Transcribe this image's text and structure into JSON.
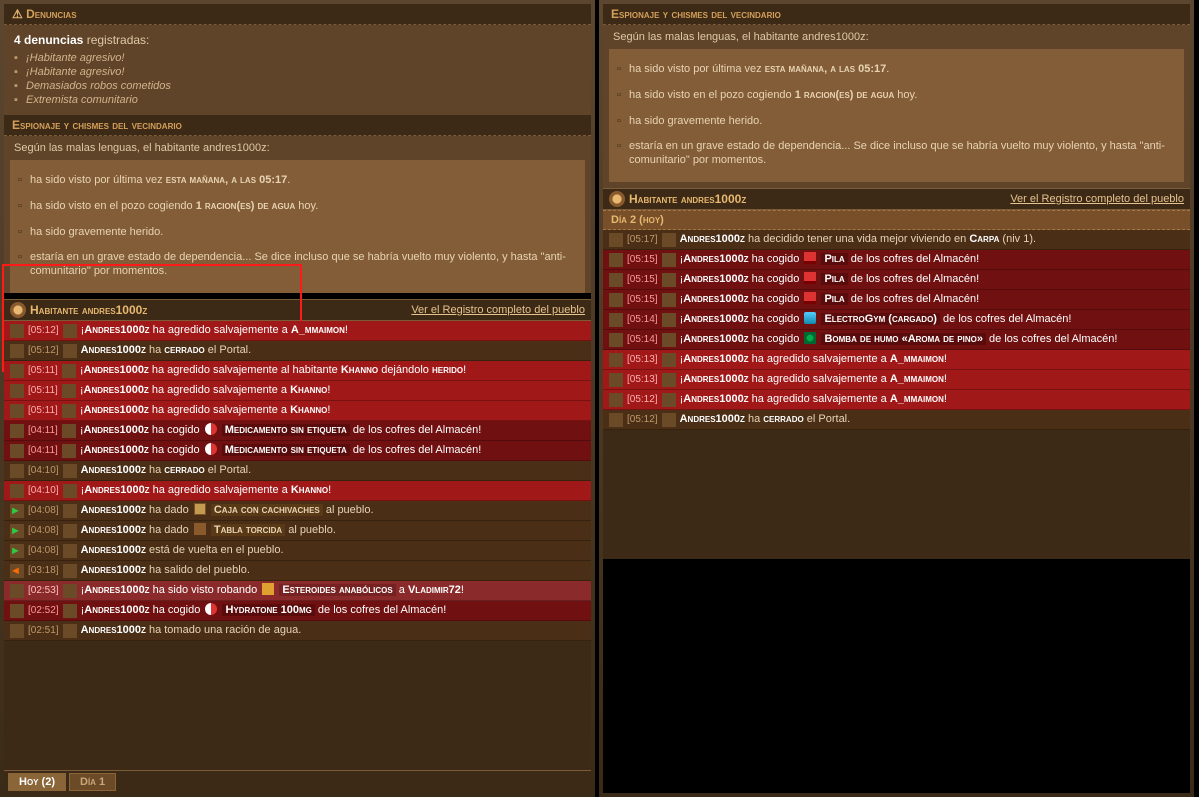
{
  "left": {
    "complaints": {
      "title": "Denuncias",
      "count_text_strong": "4 denuncias",
      "count_text_rest": " registradas:",
      "items": [
        "¡Habitante agresivo!",
        "¡Habitante agresivo!",
        "Demasiados robos cometidos",
        "Extremista comunitario"
      ]
    },
    "gossip": {
      "title": "Espionaje y chismes del vecindario",
      "intro": "Según las malas lenguas, el habitante andres1000z:",
      "lines": [
        {
          "html": "ha sido visto por última vez <strong class='sc'>esta mañana, a las 05:17</strong>."
        },
        {
          "html": "ha sido visto en el pozo cogiendo <strong class='sc'>1 racion(es) de agua</strong> hoy."
        },
        {
          "html": "ha sido gravemente herido."
        },
        {
          "html": "estaría en un grave estado de dependencia... Se dice incluso que se habría vuelto muy violento, y hasta \"anti-comunitario\" por momentos."
        }
      ]
    },
    "header": {
      "label": "Habitante andres1000z",
      "link": "Ver el Registro completo del pueblo"
    },
    "tabs": [
      {
        "label": "Hoy (2)",
        "active": true
      },
      {
        "label": "Día 1",
        "active": false
      }
    ],
    "log": [
      {
        "sev": "hi",
        "time": "[05:12]",
        "html": "¡<span class='nm'>Andres1000z</span> ha agredido salvajemente a <span class='nm'>A_mmaimon</span>!"
      },
      {
        "sev": "low",
        "time": "[05:12]",
        "html": "<span class='nm'>Andres1000z</span> ha <span class='nm'>cerrado</span> el Portal."
      },
      {
        "sev": "hi",
        "time": "[05:11]",
        "html": "¡<span class='nm'>Andres1000z</span> ha agredido salvajemente al habitante <span class='nm'>Khanno</span> dejándolo <span class='nm'>herido</span>!"
      },
      {
        "sev": "hi",
        "time": "[05:11]",
        "html": "¡<span class='nm'>Andres1000z</span> ha agredido salvajemente a <span class='nm'>Khanno</span>!"
      },
      {
        "sev": "hi",
        "time": "[05:11]",
        "html": "¡<span class='nm'>Andres1000z</span> ha agredido salvajemente a <span class='nm'>Khanno</span>!"
      },
      {
        "sev": "med",
        "time": "[04:11]",
        "html": "¡<span class='nm'>Andres1000z</span> ha cogido <span class='iicon pill'></span> <span class='itm'>Medicamento sin etiqueta</span> de los cofres del Almacén!"
      },
      {
        "sev": "med",
        "time": "[04:11]",
        "html": "¡<span class='nm'>Andres1000z</span> ha cogido <span class='iicon pill'></span> <span class='itm'>Medicamento sin etiqueta</span> de los cofres del Almacén!"
      },
      {
        "sev": "low",
        "time": "[04:10]",
        "html": "<span class='nm'>Andres1000z</span> ha <span class='nm'>cerrado</span> el Portal."
      },
      {
        "sev": "hi",
        "time": "[04:10]",
        "html": "¡<span class='nm'>Andres1000z</span> ha agredido salvajemente a <span class='nm'>Khanno</span>!"
      },
      {
        "sev": "low",
        "time": "[04:08]",
        "arrow": "in",
        "html": "<span class='nm'>Andres1000z</span> ha dado <span class='iicon box'></span> <span class='itm' style='background:#5a3a16;'>Caja con cachivaches</span> al pueblo."
      },
      {
        "sev": "low",
        "time": "[04:08]",
        "arrow": "in",
        "html": "<span class='nm'>Andres1000z</span> ha dado <span class='iicon wood'></span> <span class='itm' style='background:#5a3a16;'>Tabla torcida</span> al pueblo."
      },
      {
        "sev": "low",
        "time": "[04:08]",
        "arrow": "in",
        "html": "<span class='nm'>Andres1000z</span> está de vuelta en el pueblo."
      },
      {
        "sev": "low",
        "time": "[03:18]",
        "arrow": "out",
        "html": "<span class='nm'>Andres1000z</span> ha salido del pueblo."
      },
      {
        "sev": "med2",
        "time": "[02:53]",
        "html": "¡<span class='nm'>Andres1000z</span> ha sido visto robando <span class='iicon dumb'></span> <span class='itm'>Esteroides anabólicos</span> a <span class='nm'>Vladimir72</span>!"
      },
      {
        "sev": "med",
        "time": "[02:52]",
        "html": "¡<span class='nm'>Andres1000z</span> ha cogido <span class='iicon pill'></span> <span class='itm'>Hydratone 100mg</span> de los cofres del Almacén!"
      },
      {
        "sev": "low",
        "time": "[02:51]",
        "html": "<span class='nm'>Andres1000z</span> ha tomado una ración de agua."
      }
    ]
  },
  "right": {
    "gossip": {
      "title": "Espionaje y chismes del vecindario",
      "intro": "Según las malas lenguas, el habitante andres1000z:",
      "lines": [
        {
          "html": "ha sido visto por última vez <strong class='sc'>esta mañana, a las 05:17</strong>."
        },
        {
          "html": "ha sido visto en el pozo cogiendo <strong class='sc'>1 racion(es) de agua</strong> hoy."
        },
        {
          "html": "ha sido gravemente herido."
        },
        {
          "html": "estaría en un grave estado de dependencia... Se dice incluso que se habría vuelto muy violento, y hasta \"anti-comunitario\" por momentos."
        }
      ]
    },
    "header": {
      "label": "Habitante andres1000z",
      "link": "Ver el Registro completo del pueblo"
    },
    "day": "Día 2 (hoy)",
    "log": [
      {
        "sev": "low",
        "time": "[05:17]",
        "html": "<span class='nm'>Andres1000z</span> ha decidido tener una vida mejor viviendo en <span class='nm'>Carpa</span> (niv 1)."
      },
      {
        "sev": "med",
        "time": "[05:15]",
        "html": "¡<span class='nm'>Andres1000z</span> ha cogido <span class='iicon batt'></span> <span class='itm'>Pila</span> de los cofres del Almacén!"
      },
      {
        "sev": "med",
        "time": "[05:15]",
        "html": "¡<span class='nm'>Andres1000z</span> ha cogido <span class='iicon batt'></span> <span class='itm'>Pila</span> de los cofres del Almacén!"
      },
      {
        "sev": "med",
        "time": "[05:15]",
        "html": "¡<span class='nm'>Andres1000z</span> ha cogido <span class='iicon batt'></span> <span class='itm'>Pila</span> de los cofres del Almacén!"
      },
      {
        "sev": "med",
        "time": "[05:14]",
        "html": "¡<span class='nm'>Andres1000z</span> ha cogido <span class='iicon bottle'></span> <span class='itm'>ElectroGym (cargado)</span> de los cofres del Almacén!"
      },
      {
        "sev": "med",
        "time": "[05:14]",
        "html": "¡<span class='nm'>Andres1000z</span> ha cogido <span class='iicon smoke'></span> <span class='itm'>Bomba de humo «Aroma de pino»</span> de los cofres del Almacén!"
      },
      {
        "sev": "hi",
        "time": "[05:13]",
        "html": "¡<span class='nm'>Andres1000z</span> ha agredido salvajemente a <span class='nm'>A_mmaimon</span>!"
      },
      {
        "sev": "hi",
        "time": "[05:13]",
        "html": "¡<span class='nm'>Andres1000z</span> ha agredido salvajemente a <span class='nm'>A_mmaimon</span>!"
      },
      {
        "sev": "hi",
        "time": "[05:12]",
        "html": "¡<span class='nm'>Andres1000z</span> ha agredido salvajemente a <span class='nm'>A_mmaimon</span>!"
      },
      {
        "sev": "low",
        "time": "[05:12]",
        "html": "<span class='nm'>Andres1000z</span> ha <span class='nm'>cerrado</span> el Portal."
      }
    ]
  }
}
